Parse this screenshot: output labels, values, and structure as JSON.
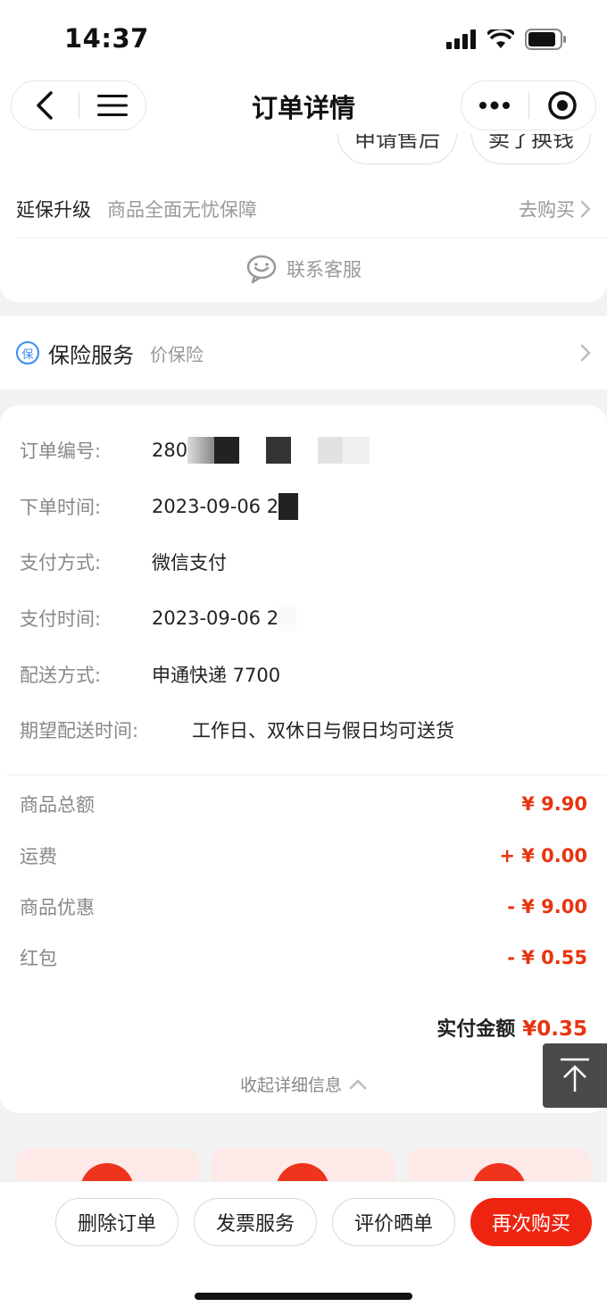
{
  "status": {
    "time": "14:37"
  },
  "nav": {
    "title": "订单详情"
  },
  "top_card": {
    "action_buttons": [
      "申请售后",
      "卖了换钱"
    ],
    "warranty": {
      "title": "延保升级",
      "desc": "商品全面无忧保障",
      "link": "去购买"
    },
    "customer_service": "联系客服"
  },
  "insurance": {
    "badge": "保",
    "title": "保险服务",
    "desc": "价保险"
  },
  "order_info": {
    "rows": [
      {
        "label": "订单编号:",
        "value": "280"
      },
      {
        "label": "下单时间:",
        "value": "2023-09-06 2"
      },
      {
        "label": "支付方式:",
        "value": "微信支付"
      },
      {
        "label": "支付时间:",
        "value": "2023-09-06 2"
      },
      {
        "label": "配送方式:",
        "value": "申通快递 7700"
      },
      {
        "label": "期望配送时间:",
        "value": "工作日、双休日与假日均可送货"
      }
    ]
  },
  "fees": [
    {
      "label": "商品总额",
      "value": "¥ 9.90"
    },
    {
      "label": "运费",
      "value": "+ ¥ 0.00"
    },
    {
      "label": "商品优惠",
      "value": "- ¥ 9.00"
    },
    {
      "label": "红包",
      "value": "- ¥ 0.55"
    }
  ],
  "total": {
    "label": "实付金额",
    "value": "¥0.35"
  },
  "collapse_label": "收起详细信息",
  "bottom_actions": {
    "delete": "删除订单",
    "invoice": "发票服务",
    "review": "评价晒单",
    "rebuy": "再次购买"
  },
  "colors": {
    "price": "#e8340f",
    "primary": "#ee2411",
    "info_blue": "#3b8cf0"
  },
  "icons": [
    "back-arrow-icon",
    "menu-icon",
    "more-dots-icon",
    "target-icon",
    "chevron-right-icon",
    "customer-service-icon",
    "chevron-up-icon",
    "back-to-top-icon"
  ]
}
